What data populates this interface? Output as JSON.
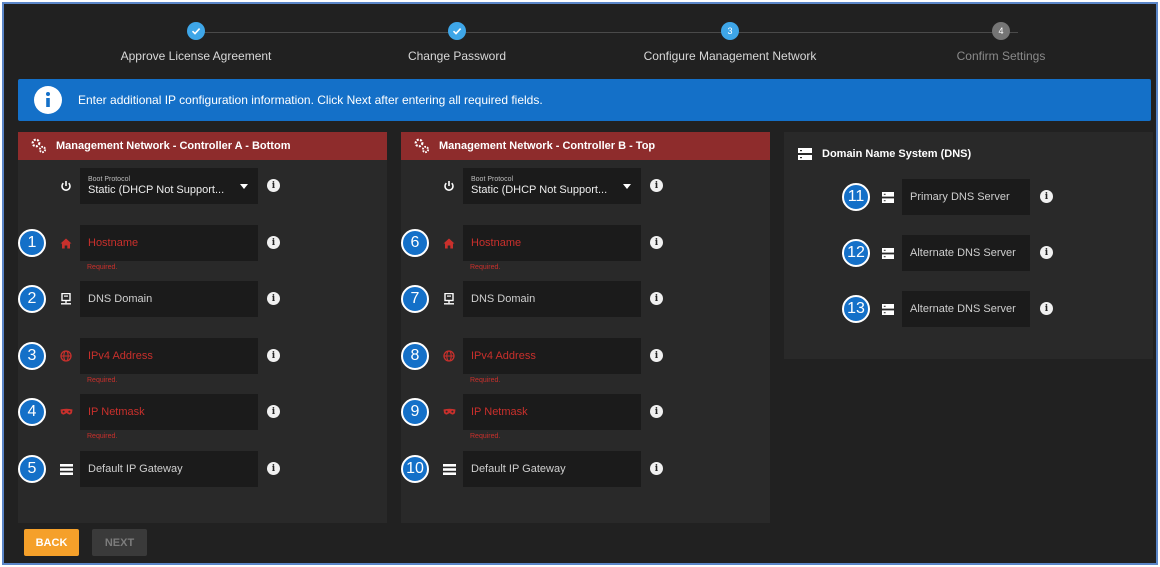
{
  "stepper": {
    "steps": [
      {
        "label": "Approve License Agreement",
        "state": "done",
        "num": ""
      },
      {
        "label": "Change Password",
        "state": "done",
        "num": ""
      },
      {
        "label": "Configure Management Network",
        "state": "active",
        "num": "3"
      },
      {
        "label": "Confirm Settings",
        "state": "todo",
        "num": "4"
      }
    ]
  },
  "banner": {
    "text": "Enter additional IP configuration information. Click Next after entering all required fields."
  },
  "controller_a": {
    "title": "Management Network - Controller A - Bottom",
    "boot_protocol": {
      "label": "Boot Protocol",
      "value": "Static (DHCP Not Support..."
    },
    "fields": [
      {
        "badge": "1",
        "placeholder": "Hostname",
        "required": "Required.",
        "icon": "home-icon"
      },
      {
        "badge": "2",
        "placeholder": "DNS Domain",
        "required": "",
        "icon": "dns-domain-icon"
      },
      {
        "badge": "3",
        "placeholder": "IPv4 Address",
        "required": "Required.",
        "icon": "globe-icon"
      },
      {
        "badge": "4",
        "placeholder": "IP Netmask",
        "required": "Required.",
        "icon": "mask-icon"
      },
      {
        "badge": "5",
        "placeholder": "Default IP Gateway",
        "required": "",
        "icon": "gateway-icon"
      }
    ]
  },
  "controller_b": {
    "title": "Management Network - Controller B - Top",
    "boot_protocol": {
      "label": "Boot Protocol",
      "value": "Static (DHCP Not Support..."
    },
    "fields": [
      {
        "badge": "6",
        "placeholder": "Hostname",
        "required": "Required.",
        "icon": "home-icon"
      },
      {
        "badge": "7",
        "placeholder": "DNS Domain",
        "required": "",
        "icon": "dns-domain-icon"
      },
      {
        "badge": "8",
        "placeholder": "IPv4 Address",
        "required": "Required.",
        "icon": "globe-icon"
      },
      {
        "badge": "9",
        "placeholder": "IP Netmask",
        "required": "Required.",
        "icon": "mask-icon"
      },
      {
        "badge": "10",
        "placeholder": "Default IP Gateway",
        "required": "",
        "icon": "gateway-icon"
      }
    ]
  },
  "dns": {
    "title": "Domain Name System (DNS)",
    "servers": [
      {
        "badge": "11",
        "placeholder": "Primary DNS Server"
      },
      {
        "badge": "12",
        "placeholder": "Alternate DNS Server"
      },
      {
        "badge": "13",
        "placeholder": "Alternate DNS Server"
      }
    ]
  },
  "buttons": {
    "back": "BACK",
    "next": "NEXT"
  },
  "colors": {
    "accent": "#1470c8",
    "header_red": "#8e2c2c",
    "error": "#c9302c",
    "back_button": "#f5a02a",
    "step_done": "#3ea6e8"
  }
}
